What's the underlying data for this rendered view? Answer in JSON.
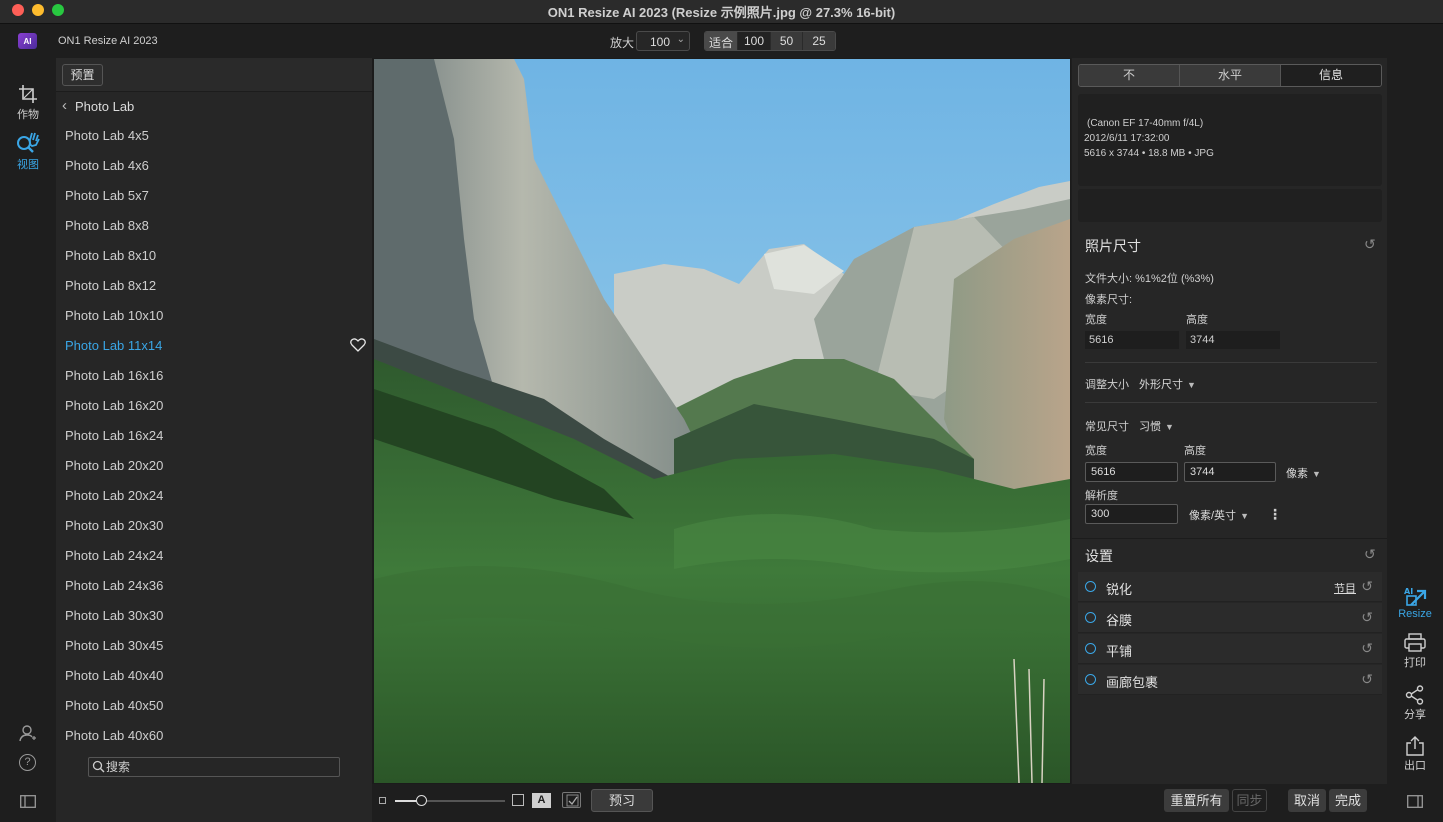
{
  "window": {
    "title": "ON1 Resize AI 2023 (Resize 示例照片.jpg @ 27.3% 16-bit)"
  },
  "toolbar": {
    "app_name": "ON1 Resize AI 2023",
    "logo_text": "AI",
    "zoom_label": "放大",
    "zoom_value": "100",
    "fit_label": "适合",
    "fit_options": [
      "100",
      "50",
      "25"
    ]
  },
  "left_rail": {
    "crop_label": "作物",
    "view_label": "视图",
    "help_label": "?"
  },
  "presets": {
    "presets_button": "预置",
    "back_label": "Photo Lab",
    "active_index": 7,
    "items": [
      "Photo Lab 4x5",
      "Photo Lab 4x6",
      "Photo Lab 5x7",
      "Photo Lab 8x8",
      "Photo Lab 8x10",
      "Photo Lab 8x12",
      "Photo Lab 10x10",
      "Photo Lab 11x14",
      "Photo Lab 16x16",
      "Photo Lab 16x20",
      "Photo Lab 16x24",
      "Photo Lab 20x20",
      "Photo Lab 20x24",
      "Photo Lab 20x30",
      "Photo Lab 24x24",
      "Photo Lab 24x36",
      "Photo Lab 30x30",
      "Photo Lab 30x45",
      "Photo Lab 40x40",
      "Photo Lab 40x50",
      "Photo Lab 40x60"
    ],
    "search_placeholder": "搜索"
  },
  "bottom_bar": {
    "a_label": "A",
    "preview_label": "预习",
    "reset_all_label": "重置所有",
    "sync_label": "同步",
    "cancel_label": "取消",
    "done_label": "完成"
  },
  "right_panel": {
    "tabs": [
      "不",
      "水平",
      "信息"
    ],
    "active_tab": 2,
    "info": {
      "lens": "(Canon EF 17-40mm f/4L)",
      "datetime": "2012/6/11  17:32:00",
      "dimensions": "5616 x 3744 • 18.8 MB • JPG"
    },
    "photo_size": {
      "title": "照片尺寸",
      "file_size": "文件大小:  %1%2位 (%3%)",
      "pixel_size_label": "像素尺寸:",
      "width_label": "宽度",
      "height_label": "高度",
      "width_value": "5616",
      "height_value": "3744",
      "resize_label": "调整大小",
      "resize_mode": "外形尺寸",
      "common_size_label": "常见尺寸",
      "common_size_value": "习惯",
      "new_width_label": "宽度",
      "new_height_label": "高度",
      "new_width": "5616",
      "new_height": "3744",
      "unit": "像素",
      "resolution_label": "解析度",
      "resolution": "300",
      "resolution_unit": "像素/英寸",
      "more_icon": "⋮"
    },
    "settings": {
      "title": "设置",
      "rows": [
        {
          "name": "锐化",
          "preset": "节目"
        },
        {
          "name": "谷膜",
          "preset": ""
        },
        {
          "name": "平铺",
          "preset": ""
        },
        {
          "name": "画廊包裹",
          "preset": ""
        }
      ]
    }
  },
  "right_rail": {
    "resize_label": "Resize",
    "print_label": "打印",
    "share_label": "分享",
    "export_label": "出口"
  },
  "colors": {
    "accent": "#3aa6e6",
    "panel": "#262626",
    "background": "#1e1e1e"
  }
}
